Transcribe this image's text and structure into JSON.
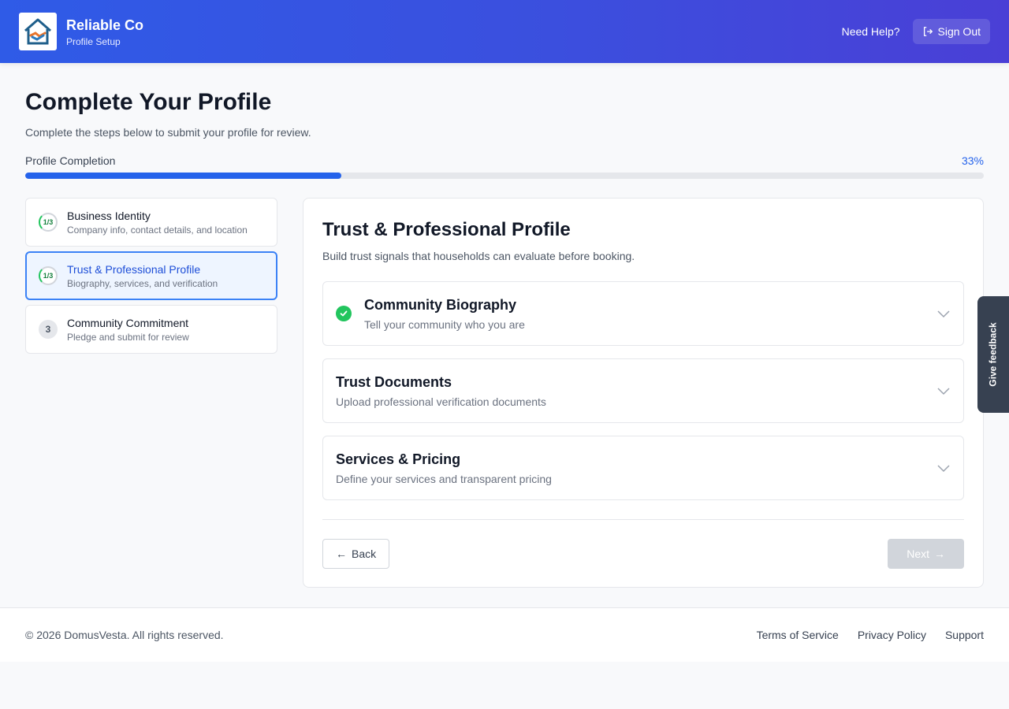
{
  "header": {
    "brand_name": "Reliable Co",
    "brand_sub": "Profile Setup",
    "help_label": "Need Help?",
    "signout_label": "Sign Out"
  },
  "page": {
    "title": "Complete Your Profile",
    "subtitle": "Complete the steps below to submit your profile for review.",
    "progress_label": "Profile Completion",
    "progress_pct_label": "33%",
    "progress_fraction": 0.33
  },
  "steps": [
    {
      "badge": "1/3",
      "title": "Business Identity",
      "desc": "Company info, contact details, and location",
      "state": "partial"
    },
    {
      "badge": "1/3",
      "title": "Trust & Professional Profile",
      "desc": "Biography, services, and verification",
      "state": "active"
    },
    {
      "badge": "3",
      "title": "Community Commitment",
      "desc": "Pledge and submit for review",
      "state": "pending"
    }
  ],
  "panel": {
    "title": "Trust & Professional Profile",
    "subtitle": "Build trust signals that households can evaluate before booking.",
    "sections": [
      {
        "title": "Community Biography",
        "desc": "Tell your community who you are",
        "complete": true
      },
      {
        "title": "Trust Documents",
        "desc": "Upload professional verification documents",
        "complete": false
      },
      {
        "title": "Services & Pricing",
        "desc": "Define your services and transparent pricing",
        "complete": false
      }
    ],
    "back_label": "Back",
    "next_label": "Next"
  },
  "feedback_label": "Give feedback",
  "footer": {
    "copyright": "© 2026 DomusVesta. All rights reserved.",
    "links": [
      "Terms of Service",
      "Privacy Policy",
      "Support"
    ]
  },
  "colors": {
    "accent": "#2563eb",
    "success": "#22c55e",
    "header_start": "#2f5be7",
    "header_end": "#4a3fd6"
  }
}
